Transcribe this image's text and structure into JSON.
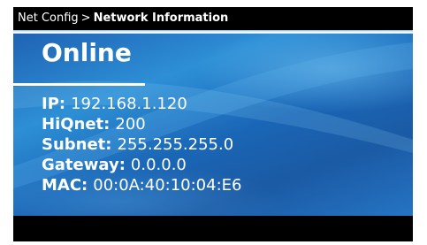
{
  "header": {
    "breadcrumb_parent": "Net Config",
    "separator": ">",
    "breadcrumb_current": "Network Information"
  },
  "status": "Online",
  "info": [
    {
      "label": "IP:",
      "value": "192.168.1.120"
    },
    {
      "label": "HiQnet:",
      "value": "200"
    },
    {
      "label": "Subnet:",
      "value": "255.255.255.0"
    },
    {
      "label": "Gateway:",
      "value": "0.0.0.0"
    },
    {
      "label": "MAC:",
      "value": "00:0A:40:10:04:E6"
    }
  ],
  "colors": {
    "title_bar": "#000000",
    "panel_blue": "#1f63b3",
    "text": "#ffffff"
  }
}
